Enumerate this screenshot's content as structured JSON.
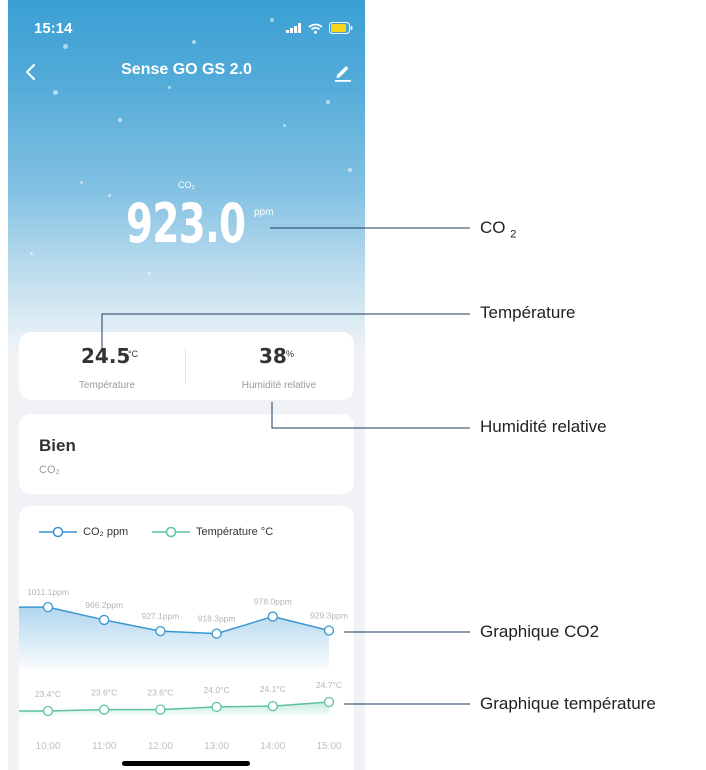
{
  "status_bar": {
    "time": "15:14"
  },
  "header": {
    "title": "Sense GO GS 2.0",
    "back_icon": "chevron-left-icon",
    "edit_icon": "pencil-icon"
  },
  "co2": {
    "label": "CO₂",
    "value": "923.0",
    "unit": "ppm"
  },
  "metrics": {
    "temperature": {
      "value": "24.5",
      "unit": "°C",
      "label": "Température"
    },
    "humidity": {
      "value": "38",
      "unit": "%",
      "label": "Humidité relative"
    }
  },
  "status_card": {
    "title": "Bien",
    "subtitle": "CO₂"
  },
  "legend": {
    "co2": "CO₂ ppm",
    "temperature": "Température °C"
  },
  "colors": {
    "co2_line": "#3a96d0",
    "temp_line": "#5cc2a2",
    "hero_top": "#3a9fd4"
  },
  "chart_data": {
    "type": "line",
    "x": [
      "10:00",
      "11:00",
      "12:00",
      "13:00",
      "14:00",
      "15:00"
    ],
    "series": [
      {
        "name": "CO₂ ppm",
        "values": [
          1011.1,
          966.2,
          927.1,
          918.3,
          978.0,
          929.3
        ],
        "labels": [
          "1011.1ppm",
          "966.2ppm",
          "927.1ppm",
          "918.3ppm",
          "978.0ppm",
          "929.3ppm"
        ]
      },
      {
        "name": "Température °C",
        "values": [
          23.4,
          23.6,
          23.6,
          24.0,
          24.1,
          24.7
        ],
        "labels": [
          "23.4°C",
          "23.6°C",
          "23.6°C",
          "24.0°C",
          "24.1°C",
          "24.7°C"
        ]
      }
    ]
  },
  "callouts": {
    "co2": "CO2",
    "temperature": "Température",
    "humidity": "Humidité relative",
    "co2_chart": "Graphique CO2",
    "temp_chart": "Graphique température"
  }
}
